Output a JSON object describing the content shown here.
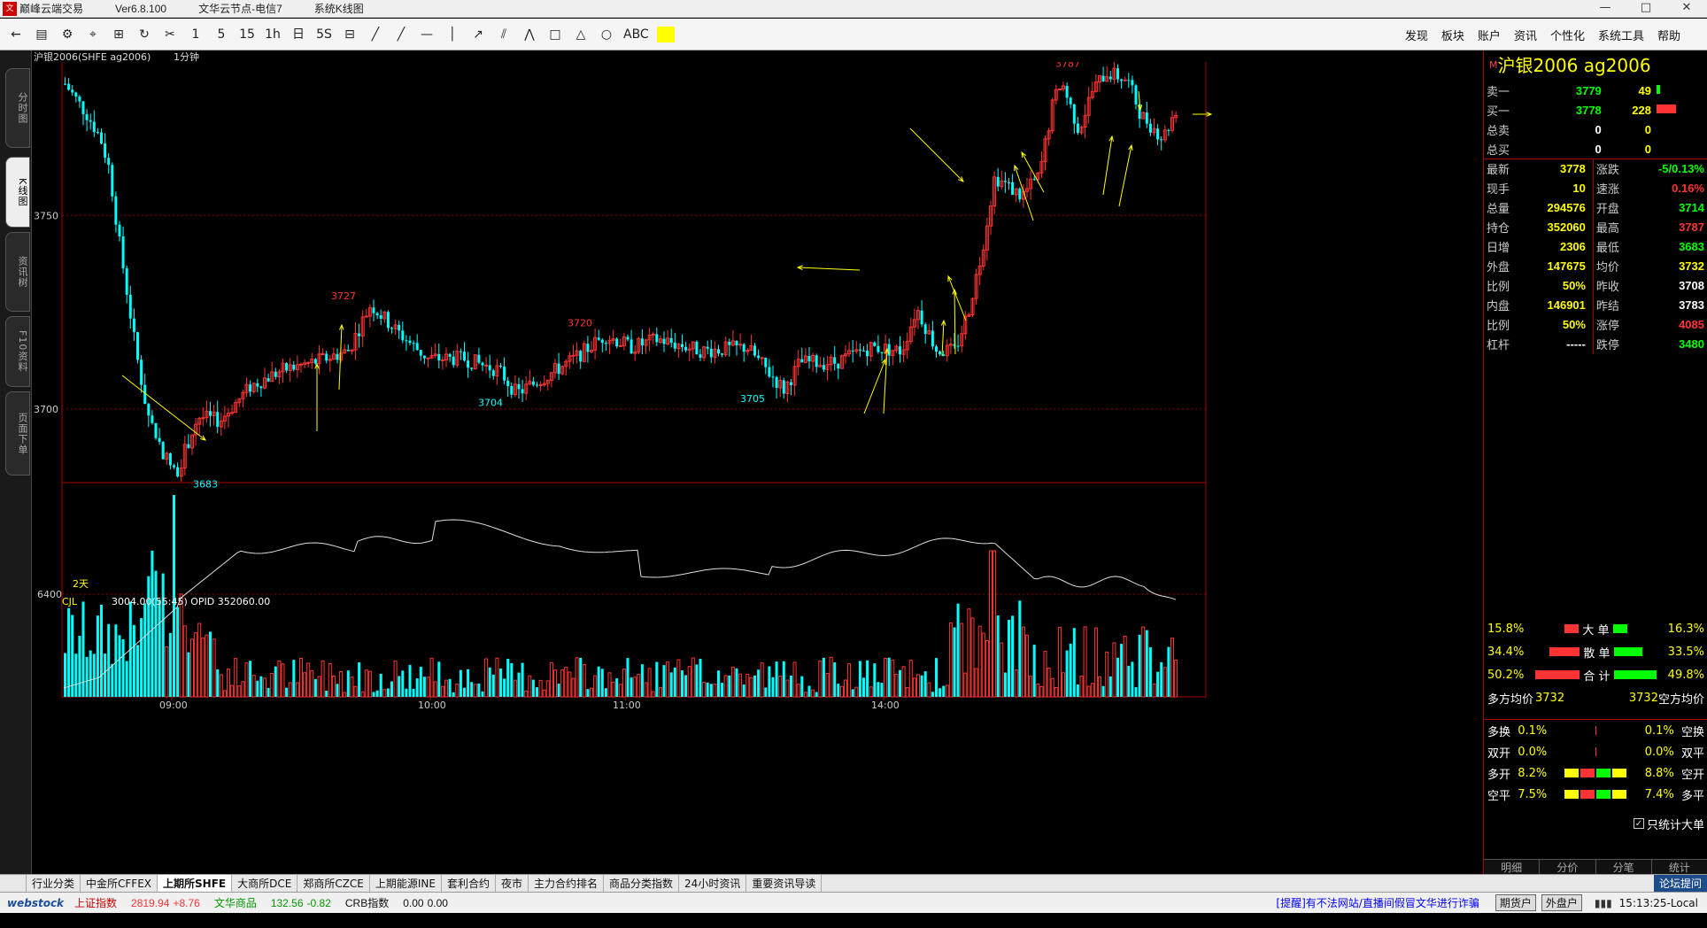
{
  "app": {
    "title": "巅峰云端交易",
    "version": "Ver6.8.100",
    "server": "文华云节点-电信7",
    "view": "系统K线图"
  },
  "window": {
    "minimize": "—",
    "maximize": "□",
    "close": "✕"
  },
  "toolbar": {
    "tools": [
      "←",
      "▤",
      "⚙",
      "⌖",
      "⊞",
      "↻",
      "✂",
      "1",
      "5",
      "15",
      "1h",
      "日",
      "5S",
      "⊟",
      "╱",
      "╱",
      "—",
      "│",
      "↗",
      "⫽",
      "⋀",
      "□",
      "△",
      "○",
      "ABC"
    ],
    "color": "#ffff00"
  },
  "menu": [
    "发现",
    "板块",
    "账户",
    "资讯",
    "个性化",
    "系统工具",
    "帮助"
  ],
  "leftnav": [
    "分时图",
    "K线图",
    "资讯树",
    "F10资料",
    "页面下单"
  ],
  "chart": {
    "symbol": "沪银2006(SHFE ag2006)",
    "period": "1分钟",
    "period_label": "2天",
    "indicator": "CJL",
    "indicator_values": "3004.00(55:45)  OPID 352060.00",
    "price_labels": [
      "3750",
      "3700"
    ],
    "volume_label": "6400",
    "time_labels": [
      "09:00",
      "10:00",
      "11:00",
      "14:00"
    ],
    "annotations": [
      "3787",
      "3727",
      "3720",
      "3704",
      "3705",
      "3683"
    ]
  },
  "chart_data": {
    "type": "candlestick",
    "y_ticks": [
      3750,
      3700
    ],
    "price_range": [
      3680,
      3792
    ],
    "x_ticks": [
      "09:00",
      "10:00",
      "11:00",
      "14:00"
    ],
    "open": 3714,
    "high": 3787,
    "low": 3683,
    "last": 3778,
    "marked_highs": [
      3787,
      3727,
      3720
    ],
    "marked_lows": [
      3683,
      3704,
      3705
    ],
    "volume_tick": 6400
  },
  "quote": {
    "header": "沪银2006  ag2006",
    "header_tag": "M",
    "book": [
      {
        "label": "卖一",
        "price": "3779",
        "vol": "49"
      },
      {
        "label": "买一",
        "price": "3778",
        "vol": "228"
      },
      {
        "label": "总卖",
        "price": "0",
        "vol": "0"
      },
      {
        "label": "总买",
        "price": "0",
        "vol": "0"
      }
    ],
    "rows": [
      [
        "最新",
        "3778",
        "涨跌",
        "-5/0.13%"
      ],
      [
        "现手",
        "10",
        "速涨",
        "0.16%"
      ],
      [
        "总量",
        "294576",
        "开盘",
        "3714"
      ],
      [
        "持仓",
        "352060",
        "最高",
        "3787"
      ],
      [
        "日增",
        "2306",
        "最低",
        "3683"
      ],
      [
        "外盘",
        "147675",
        "均价",
        "3732"
      ],
      [
        "比例",
        "50%",
        "昨收",
        "3708"
      ],
      [
        "内盘",
        "146901",
        "昨结",
        "3783"
      ],
      [
        "比例",
        "50%",
        "涨停",
        "4085"
      ],
      [
        "杠杆",
        "-----",
        "跌停",
        "3480"
      ]
    ]
  },
  "flow": {
    "large": {
      "l": "15.8%",
      "name": "大 单",
      "r": "16.3%"
    },
    "retail": {
      "l": "34.4%",
      "name": "散 单",
      "r": "33.5%"
    },
    "total": {
      "l": "50.2%",
      "name": "合 计",
      "r": "49.8%"
    },
    "avg_left": "多方均价",
    "avg_left_val": "3732",
    "avg_right_val": "3732",
    "avg_right": "空方均价",
    "pos": [
      [
        "多换",
        "0.1%",
        "0.1%",
        "空换"
      ],
      [
        "双开",
        "0.0%",
        "0.0%",
        "双平"
      ],
      [
        "多开",
        "8.2%",
        "8.8%",
        "空开"
      ],
      [
        "空平",
        "7.5%",
        "7.4%",
        "多平"
      ]
    ],
    "only_large": "只统计大单"
  },
  "rtabs": [
    "明细",
    "分价",
    "分笔",
    "统计"
  ],
  "bottom_tabs": [
    "行业分类",
    "中金所CFFEX",
    "上期所SHFE",
    "大商所DCE",
    "郑商所CZCE",
    "上期能源INE",
    "套利合约",
    "夜市",
    "主力合约排名",
    "商品分类指数",
    "24小时资讯",
    "重要资讯导读"
  ],
  "forum": "论坛提问",
  "status": {
    "brand": "webstock",
    "sh": "上证指数",
    "sh_val": "2819.94",
    "sh_chg": "+8.76",
    "wh": "文华商品",
    "wh_val": "132.56",
    "wh_chg": "-0.82",
    "crb": "CRB指数",
    "crb_val": "0.00",
    "crb_chg": "0.00",
    "warn": "[提醒]有不法网站/直播间假冒文华进行诈骗",
    "b1": "期货户",
    "b2": "外盘户",
    "time": "15:13:25-Local"
  }
}
